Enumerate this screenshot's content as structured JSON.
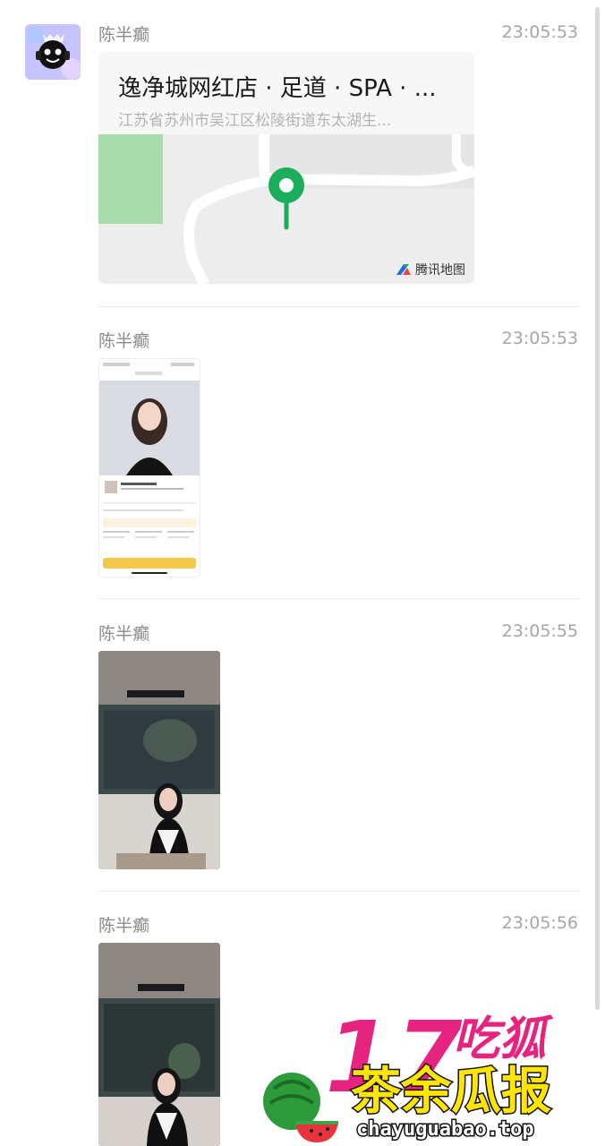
{
  "messages": [
    {
      "sender": "陈半癫",
      "time": "23:05:53",
      "type": "location",
      "location_title": "逸净城网红店 · 足道 · SPA · ...",
      "location_address": "江苏省苏州市吴江区松陵街道东太湖生...",
      "map_brand": "腾讯地图"
    },
    {
      "sender": "陈半癫",
      "time": "23:05:53",
      "type": "image",
      "image_kind": "phone-screenshot"
    },
    {
      "sender": "陈半癫",
      "time": "23:05:55",
      "type": "image",
      "image_kind": "photo"
    },
    {
      "sender": "陈半癫",
      "time": "23:05:56",
      "type": "image",
      "image_kind": "photo"
    }
  ],
  "watermark": {
    "number": "17",
    "brand_top": "吃狐",
    "brand_bottom": "茶余瓜报",
    "url": "chayuguabao.top"
  },
  "colors": {
    "pin": "#1aad5a",
    "brand_magenta": "#e6247f",
    "brand_yellow": "#ffe500",
    "divider": "#ececec"
  },
  "icons": [
    "map-pin-icon",
    "tencent-map-logo-icon",
    "watermelon-icon"
  ]
}
